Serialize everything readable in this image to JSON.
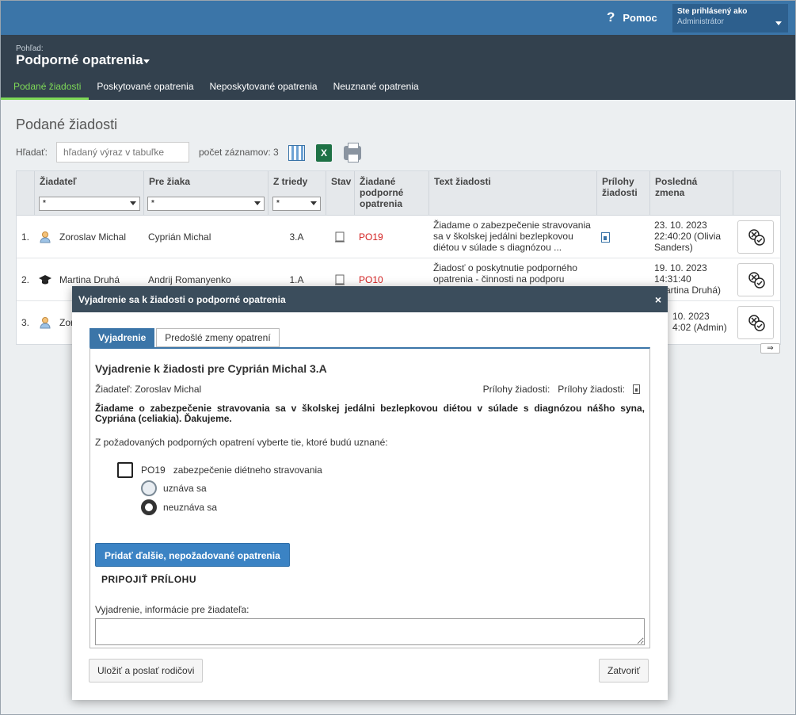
{
  "topbar": {
    "help_label": "Pomoc",
    "help_icon": "?",
    "user_line1": "Ste prihlásený ako",
    "user_line2": "Administrátor"
  },
  "header": {
    "view_label": "Pohľad:",
    "view_title": "Podporné opatrenia",
    "tabs": [
      {
        "label": "Podané žiadosti",
        "active": true
      },
      {
        "label": "Poskytované opatrenia",
        "active": false
      },
      {
        "label": "Neposkytované opatrenia",
        "active": false
      },
      {
        "label": "Neuznané opatrenia",
        "active": false
      }
    ]
  },
  "main": {
    "title": "Podané žiadosti",
    "search_label": "Hľadať:",
    "search_placeholder": "hľadaný výraz v tabuľke",
    "count_label": "počet záznamov: 3"
  },
  "table": {
    "columns": [
      "Žiadateľ",
      "Pre žiaka",
      "Z triedy",
      "Stav",
      "Žiadané podporné opatrenia",
      "Text žiadosti",
      "Prílohy žiadosti",
      "Posledná zmena"
    ],
    "filter_value": "*",
    "rows": [
      {
        "num": "1.",
        "applicant": "Zoroslav Michal",
        "applicant_type": "parent",
        "student": "Cyprián Michal",
        "class": "3.A",
        "measure": "PO19",
        "text": "Žiadame o zabezpečenie stravovania sa v školskej jedálni bezlepkovou diétou v súlade s diagnózou ...",
        "has_attachment": true,
        "changed": "23. 10. 2023 22:40:20 (Olivia Sanders)"
      },
      {
        "num": "2.",
        "applicant": "Martina Druhá",
        "applicant_type": "student",
        "student": "Andrij Romanyenko",
        "class": "1.A",
        "measure": "PO10",
        "text": "Žiadosť o poskytnutie podporného opatrenia - činnosti na podporu",
        "has_attachment": false,
        "changed": "19. 10. 2023 14:31:40 (Martina Druhá)"
      },
      {
        "num": "3.",
        "applicant": "Zor",
        "applicant_type": "parent",
        "changed_l1": "10. 2023",
        "changed_l2": "4:02 (Admin)"
      }
    ]
  },
  "modal": {
    "header": "Vyjadrenie sa k žiadosti o podporné opatrenia",
    "close_icon": "×",
    "tabs": [
      "Vyjadrenie",
      "Predošlé zmeny opatrení"
    ],
    "title": "Vyjadrenie k žiadosti pre Cyprián Michal 3.A",
    "applicant": "Žiadateľ: Zoroslav Michal",
    "attachments_label_1": "Prílohy žiadosti:",
    "attachments_label_2": "Prílohy žiadosti:",
    "request_text": "Žiadame o zabezpečenie stravovania sa v školskej jedálni bezlepkovou diétou v súlade s diagnózou nášho syna, Cypriána (celiakia). Ďakujeme.",
    "instruction": "Z požadovaných podporných opatrení vyberte tie, ktoré budú uznané:",
    "measure_code": "PO19",
    "measure_name": "zabezpečenie diétneho stravovania",
    "option_accept": "uznáva sa",
    "option_reject": "neuznáva sa",
    "add_button": "Pridať ďalšie, nepožadované opatrenia",
    "attach_link": "PRIPOJIŤ PRÍLOHU",
    "comment_label": "Vyjadrenie, informácie pre žiadateľa:",
    "comment_value": "",
    "save_button": "Uložiť a poslať rodičovi",
    "close_button": "Zatvoriť"
  }
}
